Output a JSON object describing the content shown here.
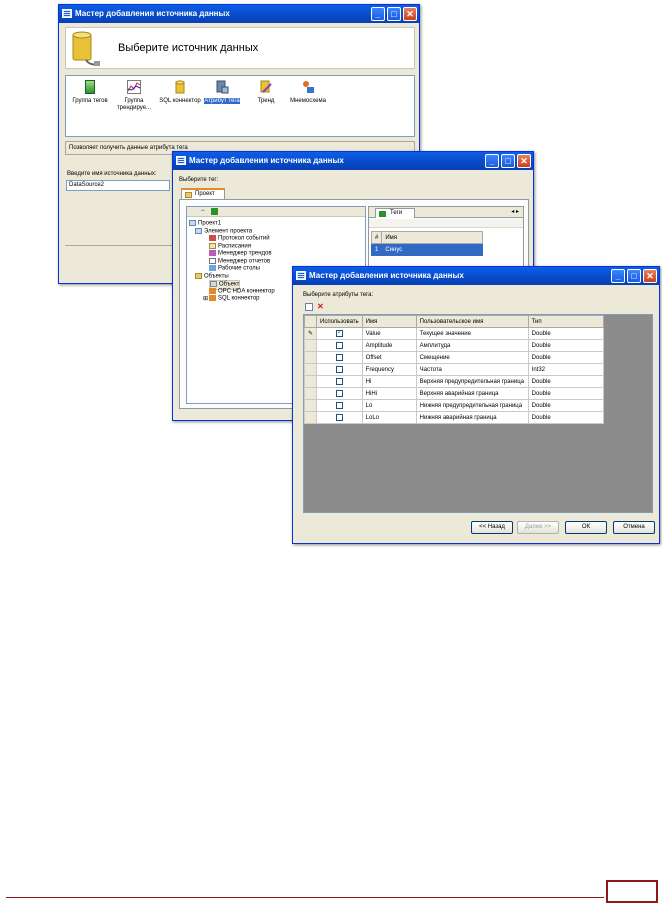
{
  "window1": {
    "title": "Мастер добавления источника данных",
    "heading": "Выберите источник данных",
    "tiles": [
      {
        "label": "Группа тегов",
        "icon": "tag-group-icon"
      },
      {
        "label": "Группа трендируе...",
        "icon": "trend-group-icon"
      },
      {
        "label": "SQL коннектор",
        "icon": "database-icon"
      },
      {
        "label": "Атрибут тега",
        "icon": "tag-attribute-icon"
      },
      {
        "label": "Тренд",
        "icon": "trend-icon"
      },
      {
        "label": "Мнемосхема",
        "icon": "mnemonic-icon"
      }
    ],
    "description": "Позволяет получить данные атрибута тега",
    "name_label": "Введите имя источника данных:",
    "name_value": "DataSource2"
  },
  "window2": {
    "title": "Мастер добавления источника данных",
    "select_tag_label": "Выберите тег:",
    "tab": "Проект",
    "tree": [
      {
        "label": "Проект1",
        "level": 0
      },
      {
        "label": "Элемент проекта",
        "level": 1
      },
      {
        "label": "Протокол событий",
        "level": 2
      },
      {
        "label": "Расписания",
        "level": 2
      },
      {
        "label": "Менеджер трендов",
        "level": 2
      },
      {
        "label": "Менеджер отчетов",
        "level": 2
      },
      {
        "label": "Рабочие столы",
        "level": 2
      },
      {
        "label": "Объекты",
        "level": 1
      },
      {
        "label": "Объект",
        "level": 2
      },
      {
        "label": "OPC HDA коннектор",
        "level": 2
      },
      {
        "label": "SQL коннектор",
        "level": 2
      }
    ],
    "tags_tab": "Теги",
    "tags_columns": [
      "#",
      "Имя"
    ],
    "tags_rows": [
      {
        "num": "1",
        "name": "Синус"
      }
    ]
  },
  "window3": {
    "title": "Мастер добавления источника данных",
    "select_attr_label": "Выберите атрибуты тега:",
    "columns": [
      "Использовать",
      "Имя",
      "Пользовательское имя",
      "Тип"
    ],
    "rows": [
      {
        "checked": true,
        "name": "Value",
        "display": "Текущее значение",
        "type": "Double"
      },
      {
        "checked": false,
        "name": "Amplitude",
        "display": "Амплитуда",
        "type": "Double"
      },
      {
        "checked": false,
        "name": "Offset",
        "display": "Смещение",
        "type": "Double"
      },
      {
        "checked": false,
        "name": "Frequency",
        "display": "Частота",
        "type": "Int32"
      },
      {
        "checked": false,
        "name": "Hi",
        "display": "Верхняя предупредительная граница",
        "type": "Double"
      },
      {
        "checked": false,
        "name": "HiHi",
        "display": "Верхняя аварийная граница",
        "type": "Double"
      },
      {
        "checked": false,
        "name": "Lo",
        "display": "Нижняя предупредительная граница",
        "type": "Double"
      },
      {
        "checked": false,
        "name": "LoLo",
        "display": "Нижняя аварийная граница",
        "type": "Double"
      }
    ],
    "buttons": {
      "back": "<< Назад",
      "next": "Далее >>",
      "ok": "ОК",
      "cancel": "Отмена"
    }
  },
  "colors": {
    "titlebar": "#0849c7",
    "selection": "#316ac5",
    "footer_line": "#8b1a1a"
  }
}
